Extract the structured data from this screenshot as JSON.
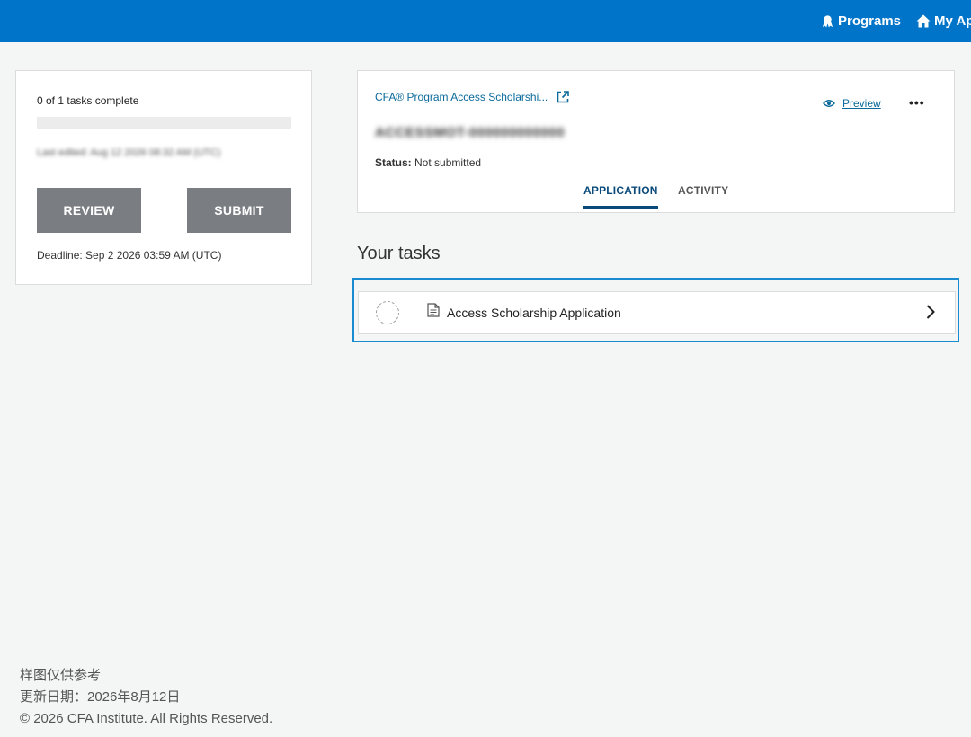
{
  "topnav": {
    "programs_label": "Programs",
    "myapps_label": "My Ap",
    "programs_icon": "award-icon",
    "myapps_icon": "home-icon",
    "bar_color": "#0074c8"
  },
  "sidebar": {
    "tasks_complete": "0 of 1 tasks complete",
    "progress_percent": 0,
    "last_edited": "Last edited: Aug 12 2026 08:32 AM (UTC)",
    "review_label": "REVIEW",
    "submit_label": "SUBMIT",
    "deadline": "Deadline: Sep 2 2026 03:59 AM (UTC)"
  },
  "application": {
    "program_link": "CFA® Program Access Scholarshi...",
    "application_id": "ACCESSMOT-000000000000",
    "status_label": "Status:",
    "status_value": "Not submitted",
    "preview_label": "Preview",
    "more_label": "•••",
    "tabs": [
      {
        "label": "APPLICATION",
        "active": true
      },
      {
        "label": "ACTIVITY",
        "active": false
      }
    ]
  },
  "tasks": {
    "heading": "Your tasks",
    "items": [
      {
        "label": "Access Scholarship Application",
        "complete": false
      }
    ]
  },
  "footer": {
    "line1": "样图仅供参考",
    "line2": "更新日期：2026年8月12日",
    "copyright": "© 2026 CFA Institute. All Rights Reserved."
  }
}
